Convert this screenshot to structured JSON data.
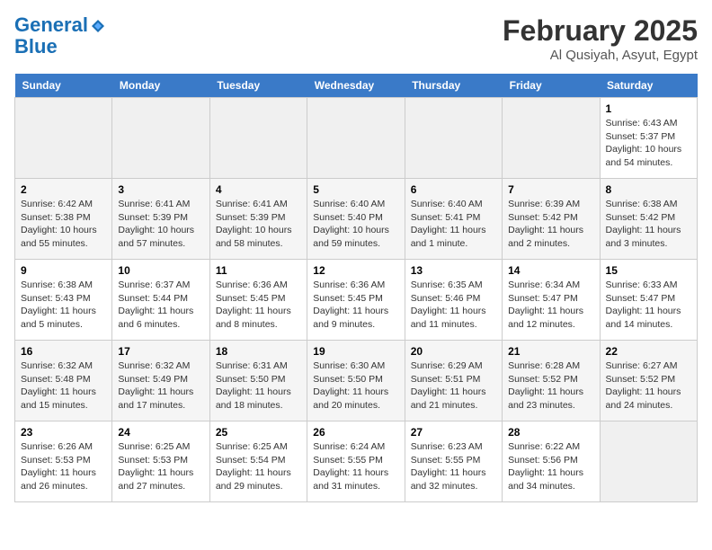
{
  "header": {
    "logo_line1": "General",
    "logo_line2": "Blue",
    "title": "February 2025",
    "subtitle": "Al Qusiyah, Asyut, Egypt"
  },
  "days_of_week": [
    "Sunday",
    "Monday",
    "Tuesday",
    "Wednesday",
    "Thursday",
    "Friday",
    "Saturday"
  ],
  "weeks": [
    [
      {
        "day": "",
        "info": ""
      },
      {
        "day": "",
        "info": ""
      },
      {
        "day": "",
        "info": ""
      },
      {
        "day": "",
        "info": ""
      },
      {
        "day": "",
        "info": ""
      },
      {
        "day": "",
        "info": ""
      },
      {
        "day": "1",
        "info": "Sunrise: 6:43 AM\nSunset: 5:37 PM\nDaylight: 10 hours and 54 minutes."
      }
    ],
    [
      {
        "day": "2",
        "info": "Sunrise: 6:42 AM\nSunset: 5:38 PM\nDaylight: 10 hours and 55 minutes."
      },
      {
        "day": "3",
        "info": "Sunrise: 6:41 AM\nSunset: 5:39 PM\nDaylight: 10 hours and 57 minutes."
      },
      {
        "day": "4",
        "info": "Sunrise: 6:41 AM\nSunset: 5:39 PM\nDaylight: 10 hours and 58 minutes."
      },
      {
        "day": "5",
        "info": "Sunrise: 6:40 AM\nSunset: 5:40 PM\nDaylight: 10 hours and 59 minutes."
      },
      {
        "day": "6",
        "info": "Sunrise: 6:40 AM\nSunset: 5:41 PM\nDaylight: 11 hours and 1 minute."
      },
      {
        "day": "7",
        "info": "Sunrise: 6:39 AM\nSunset: 5:42 PM\nDaylight: 11 hours and 2 minutes."
      },
      {
        "day": "8",
        "info": "Sunrise: 6:38 AM\nSunset: 5:42 PM\nDaylight: 11 hours and 3 minutes."
      }
    ],
    [
      {
        "day": "9",
        "info": "Sunrise: 6:38 AM\nSunset: 5:43 PM\nDaylight: 11 hours and 5 minutes."
      },
      {
        "day": "10",
        "info": "Sunrise: 6:37 AM\nSunset: 5:44 PM\nDaylight: 11 hours and 6 minutes."
      },
      {
        "day": "11",
        "info": "Sunrise: 6:36 AM\nSunset: 5:45 PM\nDaylight: 11 hours and 8 minutes."
      },
      {
        "day": "12",
        "info": "Sunrise: 6:36 AM\nSunset: 5:45 PM\nDaylight: 11 hours and 9 minutes."
      },
      {
        "day": "13",
        "info": "Sunrise: 6:35 AM\nSunset: 5:46 PM\nDaylight: 11 hours and 11 minutes."
      },
      {
        "day": "14",
        "info": "Sunrise: 6:34 AM\nSunset: 5:47 PM\nDaylight: 11 hours and 12 minutes."
      },
      {
        "day": "15",
        "info": "Sunrise: 6:33 AM\nSunset: 5:47 PM\nDaylight: 11 hours and 14 minutes."
      }
    ],
    [
      {
        "day": "16",
        "info": "Sunrise: 6:32 AM\nSunset: 5:48 PM\nDaylight: 11 hours and 15 minutes."
      },
      {
        "day": "17",
        "info": "Sunrise: 6:32 AM\nSunset: 5:49 PM\nDaylight: 11 hours and 17 minutes."
      },
      {
        "day": "18",
        "info": "Sunrise: 6:31 AM\nSunset: 5:50 PM\nDaylight: 11 hours and 18 minutes."
      },
      {
        "day": "19",
        "info": "Sunrise: 6:30 AM\nSunset: 5:50 PM\nDaylight: 11 hours and 20 minutes."
      },
      {
        "day": "20",
        "info": "Sunrise: 6:29 AM\nSunset: 5:51 PM\nDaylight: 11 hours and 21 minutes."
      },
      {
        "day": "21",
        "info": "Sunrise: 6:28 AM\nSunset: 5:52 PM\nDaylight: 11 hours and 23 minutes."
      },
      {
        "day": "22",
        "info": "Sunrise: 6:27 AM\nSunset: 5:52 PM\nDaylight: 11 hours and 24 minutes."
      }
    ],
    [
      {
        "day": "23",
        "info": "Sunrise: 6:26 AM\nSunset: 5:53 PM\nDaylight: 11 hours and 26 minutes."
      },
      {
        "day": "24",
        "info": "Sunrise: 6:25 AM\nSunset: 5:53 PM\nDaylight: 11 hours and 27 minutes."
      },
      {
        "day": "25",
        "info": "Sunrise: 6:25 AM\nSunset: 5:54 PM\nDaylight: 11 hours and 29 minutes."
      },
      {
        "day": "26",
        "info": "Sunrise: 6:24 AM\nSunset: 5:55 PM\nDaylight: 11 hours and 31 minutes."
      },
      {
        "day": "27",
        "info": "Sunrise: 6:23 AM\nSunset: 5:55 PM\nDaylight: 11 hours and 32 minutes."
      },
      {
        "day": "28",
        "info": "Sunrise: 6:22 AM\nSunset: 5:56 PM\nDaylight: 11 hours and 34 minutes."
      },
      {
        "day": "",
        "info": ""
      }
    ]
  ]
}
